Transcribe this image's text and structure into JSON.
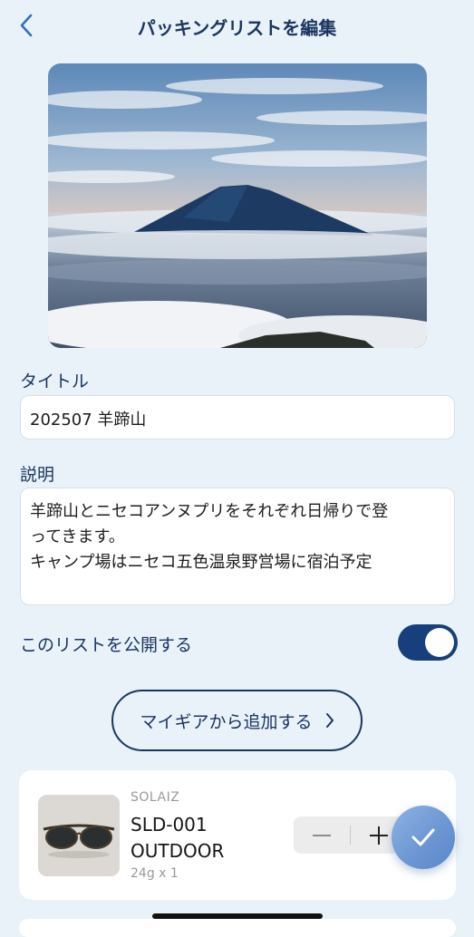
{
  "header": {
    "title": "パッキングリストを編集",
    "back_icon": "chevron-left-icon"
  },
  "hero": {
    "image": "mountain-photo"
  },
  "form": {
    "title_label": "タイトル",
    "title_value": "202507 羊蹄山",
    "description_label": "説明",
    "description_lines": [
      "羊蹄山とニセコアンヌプリをそれぞれ日帰りで登",
      "ってきます。",
      "キャンプ場はニセコ五色温泉野営場に宿泊予定"
    ],
    "public_label": "このリストを公開する",
    "public_on": true
  },
  "add_button": {
    "label": "マイギアから追加する",
    "icon": "chevron-right-icon"
  },
  "items": [
    {
      "brand": "SOLAIZ",
      "name_line1": "SLD-001",
      "name_line2": "OUTDOOR",
      "weight": "24g x 1",
      "image": "sunglasses-photo"
    }
  ],
  "colors": {
    "accent": "#173f7c",
    "label": "#1c3560",
    "background": "#e8f2f8"
  }
}
